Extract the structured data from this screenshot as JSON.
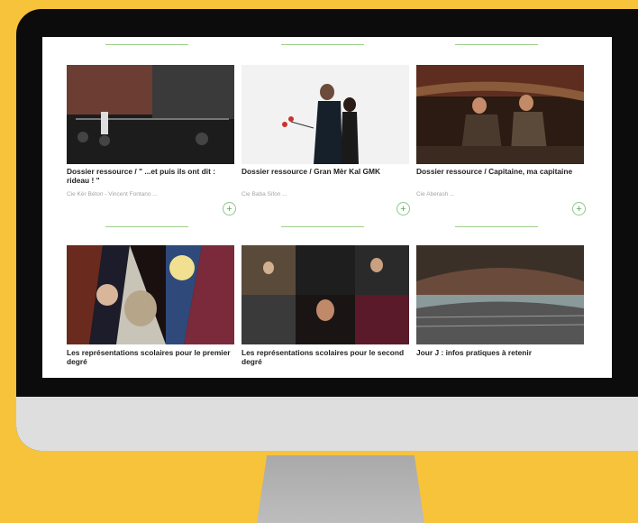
{
  "cards": [
    {
      "title": "Dossier ressource / \" ...et puis ils ont dit : rideau ! \"",
      "author": "Cie Kèr Béton - Vincent Fontano ...",
      "thumb_icon": "stage-rigging-photo",
      "plus": "+"
    },
    {
      "title": "Dossier ressource / Gran Mèr Kal GMK",
      "author": "Cie Baba Sifon ...",
      "thumb_icon": "dancers-photo",
      "plus": "+"
    },
    {
      "title": "Dossier ressource / Capitaine, ma capitaine",
      "author": "Cie Aberash ...",
      "thumb_icon": "boat-actors-photo",
      "plus": "+"
    },
    {
      "title": "Les représentations scolaires pour le premier degré",
      "thumb_icon": "collage-photo"
    },
    {
      "title": "Les représentations scolaires pour le second degré",
      "thumb_icon": "theatre-collage-photo"
    },
    {
      "title": "Jour J : infos pratiques à retenir",
      "thumb_icon": "amphitheatre-photo"
    }
  ]
}
